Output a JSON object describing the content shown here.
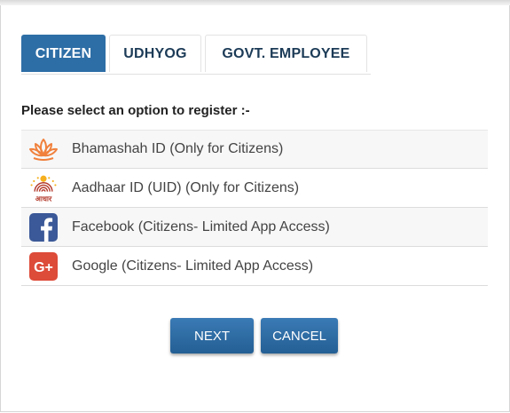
{
  "tabs": [
    {
      "label": "CITIZEN",
      "active": true
    },
    {
      "label": "UDHYOG",
      "active": false
    },
    {
      "label": "GOVT. EMPLOYEE",
      "active": false
    }
  ],
  "prompt": "Please select an option to register :-",
  "options": [
    {
      "label": "Bhamashah ID (Only for Citizens)",
      "icon": "lotus-icon"
    },
    {
      "label": "Aadhaar ID (UID) (Only for Citizens)",
      "icon": "aadhaar-icon",
      "icon_text": "आधार"
    },
    {
      "label": "Facebook (Citizens- Limited App Access)",
      "icon": "facebook-icon"
    },
    {
      "label": "Google (Citizens- Limited App Access)",
      "icon": "google-plus-icon",
      "icon_text": "G+"
    }
  ],
  "buttons": {
    "next": "NEXT",
    "cancel": "CANCEL"
  },
  "colors": {
    "accent": "#2e6ea6",
    "facebook": "#3b5998",
    "google": "#dd4b39",
    "lotus": "#f0803c"
  }
}
